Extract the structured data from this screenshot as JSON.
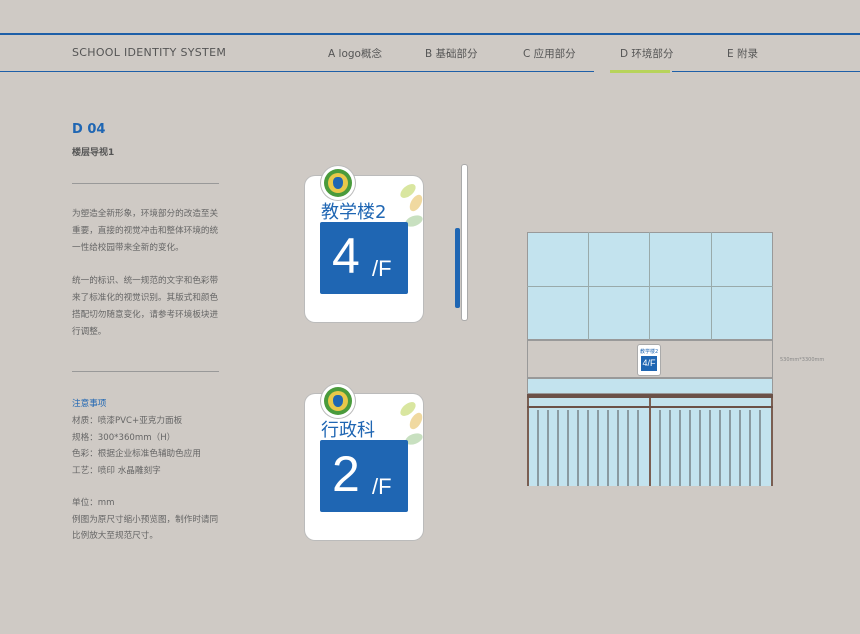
{
  "header": {
    "brand": "SCHOOL IDENTITY SYSTEM",
    "nav": [
      "A logo概念",
      "B 基础部分",
      "C 应用部分",
      "D 环境部分",
      "E 附录"
    ],
    "active_nav": "D 环境部分"
  },
  "section": {
    "code": "D 04",
    "title": "楼层导视1",
    "paragraph1": [
      "为塑造全新形象，环境部分的改造至关",
      "重要，直接的视觉冲击和整体环境的统",
      "一性给校园带来全新的变化。"
    ],
    "paragraph2": [
      "统一的标识、统一规范的文字和色彩带",
      "来了标准化的视觉识别。其版式和颜色",
      "搭配切勿随意变化，请参考环境板块进",
      "行调整。"
    ]
  },
  "notes": {
    "title": "注意事项",
    "lines": [
      "材质：喷漆PVC+亚克力面板",
      "规格：300*360mm（H）",
      "色彩：根据企业标准色辅助色应用",
      "工艺：喷印  水晶雕刻字",
      "",
      "单位：mm",
      "例图为原尺寸缩小预览图，制作时请同",
      "比例放大至规范尺寸。"
    ]
  },
  "signs": [
    {
      "name": "教学楼2",
      "floor": "4",
      "unit": "/F"
    },
    {
      "name": "行政科",
      "floor": "2",
      "unit": "/F"
    }
  ],
  "scene": {
    "mini_label": "教学楼2",
    "mini_floor": "4/F",
    "dimension": "530mm*3300mm"
  },
  "colors": {
    "brand_blue": "#1f66b3",
    "accent_green": "#b7d35b",
    "background": "#cfcac5"
  }
}
